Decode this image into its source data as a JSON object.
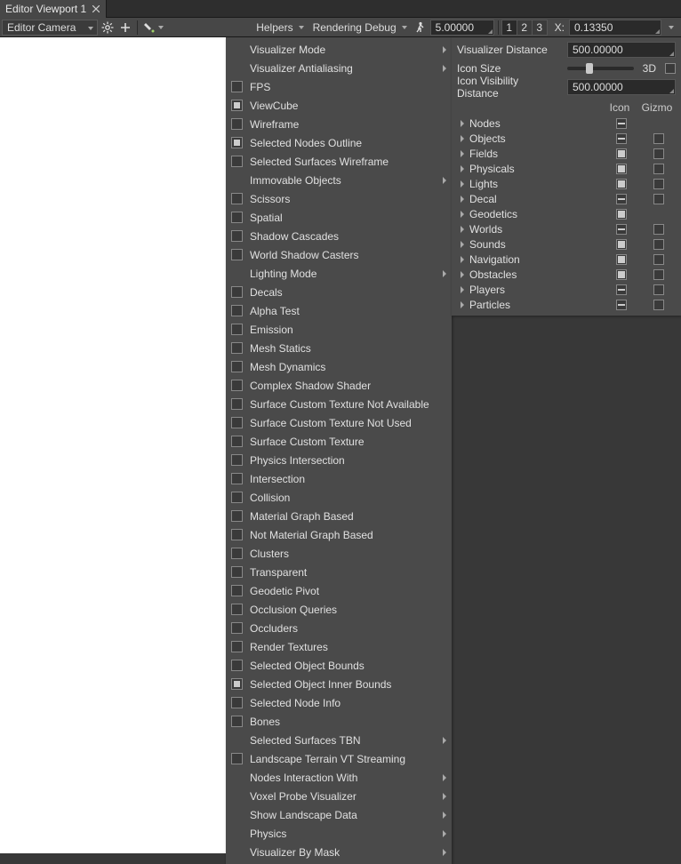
{
  "tab": {
    "title": "Editor Viewport 1"
  },
  "toolbar": {
    "camera": "Editor Camera",
    "helpers": "Helpers",
    "rendering_debug": "Rendering Debug",
    "speed": "5.00000",
    "presets": [
      "1",
      "2",
      "3"
    ],
    "active_preset": 0,
    "axis_label": "X:",
    "axis_value": "0.13350"
  },
  "right_panel": {
    "vis_dist_label": "Visualizer Distance",
    "vis_dist_value": "500.00000",
    "icon_size_label": "Icon Size",
    "icon_size_3d": "3D",
    "icon_size_pct": 28,
    "icon_vis_label": "Icon Visibility Distance",
    "icon_vis_value": "500.00000",
    "col_icon": "Icon",
    "col_gizmo": "Gizmo",
    "categories": [
      {
        "name": "Nodes",
        "icon": "dash",
        "gizmo": ""
      },
      {
        "name": "Objects",
        "icon": "dash",
        "gizmo": "off"
      },
      {
        "name": "Fields",
        "icon": "on",
        "gizmo": "off"
      },
      {
        "name": "Physicals",
        "icon": "on",
        "gizmo": "off"
      },
      {
        "name": "Lights",
        "icon": "on",
        "gizmo": "off"
      },
      {
        "name": "Decal",
        "icon": "dash",
        "gizmo": "off"
      },
      {
        "name": "Geodetics",
        "icon": "on",
        "gizmo": ""
      },
      {
        "name": "Worlds",
        "icon": "dash",
        "gizmo": "off"
      },
      {
        "name": "Sounds",
        "icon": "on",
        "gizmo": "off"
      },
      {
        "name": "Navigation",
        "icon": "on",
        "gizmo": "off"
      },
      {
        "name": "Obstacles",
        "icon": "on",
        "gizmo": "off"
      },
      {
        "name": "Players",
        "icon": "dash",
        "gizmo": "off"
      },
      {
        "name": "Particles",
        "icon": "dash",
        "gizmo": "off"
      }
    ]
  },
  "helpers_menu": [
    {
      "label": "Visualizer Mode",
      "checkbox": null,
      "submenu": true
    },
    {
      "label": "Visualizer Antialiasing",
      "checkbox": null,
      "submenu": true
    },
    {
      "label": "FPS",
      "checkbox": false,
      "submenu": false
    },
    {
      "label": "ViewCube",
      "checkbox": true,
      "submenu": false
    },
    {
      "label": "Wireframe",
      "checkbox": false,
      "submenu": false
    },
    {
      "label": "Selected Nodes Outline",
      "checkbox": true,
      "submenu": false
    },
    {
      "label": "Selected Surfaces Wireframe",
      "checkbox": false,
      "submenu": false
    },
    {
      "label": "Immovable Objects",
      "checkbox": null,
      "submenu": true
    },
    {
      "label": "Scissors",
      "checkbox": false,
      "submenu": false
    },
    {
      "label": "Spatial",
      "checkbox": false,
      "submenu": false
    },
    {
      "label": "Shadow Cascades",
      "checkbox": false,
      "submenu": false
    },
    {
      "label": "World Shadow Casters",
      "checkbox": false,
      "submenu": false
    },
    {
      "label": "Lighting Mode",
      "checkbox": null,
      "submenu": true
    },
    {
      "label": "Decals",
      "checkbox": false,
      "submenu": false
    },
    {
      "label": "Alpha Test",
      "checkbox": false,
      "submenu": false
    },
    {
      "label": "Emission",
      "checkbox": false,
      "submenu": false
    },
    {
      "label": "Mesh Statics",
      "checkbox": false,
      "submenu": false
    },
    {
      "label": "Mesh Dynamics",
      "checkbox": false,
      "submenu": false
    },
    {
      "label": "Complex Shadow Shader",
      "checkbox": false,
      "submenu": false
    },
    {
      "label": "Surface Custom Texture Not Available",
      "checkbox": false,
      "submenu": false
    },
    {
      "label": "Surface Custom Texture Not Used",
      "checkbox": false,
      "submenu": false
    },
    {
      "label": "Surface Custom Texture",
      "checkbox": false,
      "submenu": false
    },
    {
      "label": "Physics Intersection",
      "checkbox": false,
      "submenu": false
    },
    {
      "label": "Intersection",
      "checkbox": false,
      "submenu": false
    },
    {
      "label": "Collision",
      "checkbox": false,
      "submenu": false
    },
    {
      "label": "Material Graph Based",
      "checkbox": false,
      "submenu": false
    },
    {
      "label": "Not Material Graph Based",
      "checkbox": false,
      "submenu": false
    },
    {
      "label": "Clusters",
      "checkbox": false,
      "submenu": false
    },
    {
      "label": "Transparent",
      "checkbox": false,
      "submenu": false
    },
    {
      "label": "Geodetic Pivot",
      "checkbox": false,
      "submenu": false
    },
    {
      "label": "Occlusion Queries",
      "checkbox": false,
      "submenu": false
    },
    {
      "label": "Occluders",
      "checkbox": false,
      "submenu": false
    },
    {
      "label": "Render Textures",
      "checkbox": false,
      "submenu": false
    },
    {
      "label": "Selected Object Bounds",
      "checkbox": false,
      "submenu": false
    },
    {
      "label": "Selected Object Inner Bounds",
      "checkbox": true,
      "submenu": false
    },
    {
      "label": "Selected Node Info",
      "checkbox": false,
      "submenu": false
    },
    {
      "label": "Bones",
      "checkbox": false,
      "submenu": false
    },
    {
      "label": "Selected Surfaces TBN",
      "checkbox": null,
      "submenu": true
    },
    {
      "label": "Landscape Terrain VT Streaming",
      "checkbox": false,
      "submenu": false
    },
    {
      "label": "Nodes Interaction With",
      "checkbox": null,
      "submenu": true
    },
    {
      "label": "Voxel Probe Visualizer",
      "checkbox": null,
      "submenu": true
    },
    {
      "label": "Show Landscape Data",
      "checkbox": null,
      "submenu": true
    },
    {
      "label": "Physics",
      "checkbox": null,
      "submenu": true
    },
    {
      "label": "Visualizer By Mask",
      "checkbox": null,
      "submenu": true
    }
  ]
}
